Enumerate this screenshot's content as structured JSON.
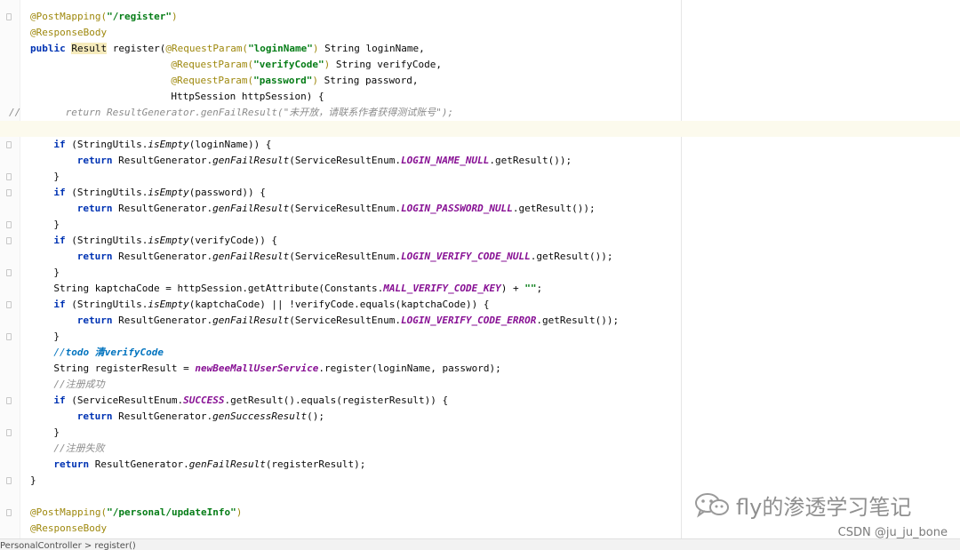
{
  "editor": {
    "lines": [
      {
        "i": 0,
        "fold": true,
        "tokens": [
          {
            "t": "@PostMapping(",
            "c": "ann"
          },
          {
            "t": "\"/register\"",
            "c": "str"
          },
          {
            "t": ")",
            "c": "ann"
          }
        ]
      },
      {
        "i": 0,
        "fold": false,
        "tokens": [
          {
            "t": "@ResponseBody",
            "c": "ann"
          }
        ]
      },
      {
        "i": 0,
        "fold": false,
        "tokens": [
          {
            "t": "public ",
            "c": "kw"
          },
          {
            "t": "Result",
            "c": "hl"
          },
          {
            "t": " register("
          },
          {
            "t": "@RequestParam(",
            "c": "ann"
          },
          {
            "t": "\"loginName\"",
            "c": "str"
          },
          {
            "t": ")",
            "c": "ann"
          },
          {
            "t": " String loginName,"
          }
        ]
      },
      {
        "i": 24,
        "fold": false,
        "tokens": [
          {
            "t": "@RequestParam(",
            "c": "ann"
          },
          {
            "t": "\"verifyCode\"",
            "c": "str"
          },
          {
            "t": ")",
            "c": "ann"
          },
          {
            "t": " String verifyCode,"
          }
        ]
      },
      {
        "i": 24,
        "fold": false,
        "tokens": [
          {
            "t": "@RequestParam(",
            "c": "ann"
          },
          {
            "t": "\"password\"",
            "c": "str"
          },
          {
            "t": ")",
            "c": "ann"
          },
          {
            "t": " String password,"
          }
        ]
      },
      {
        "i": 24,
        "fold": false,
        "tokens": [
          {
            "t": "HttpSession httpSession) {"
          }
        ]
      },
      {
        "i": 6,
        "fold": false,
        "prefix": "//",
        "tokens": [
          {
            "t": "return ResultGenerator.genFailResult(\"未开放，请联系作者获得测试账号\");",
            "c": "cmt"
          }
        ]
      },
      {
        "i": 0,
        "fold": false,
        "current": true,
        "tokens": []
      },
      {
        "i": 4,
        "fold": true,
        "tokens": [
          {
            "t": "if ",
            "c": "kw"
          },
          {
            "t": "(StringUtils."
          },
          {
            "t": "isEmpty",
            "c": "it"
          },
          {
            "t": "(loginName)) {"
          }
        ]
      },
      {
        "i": 8,
        "fold": false,
        "tokens": [
          {
            "t": "return ",
            "c": "kw"
          },
          {
            "t": "ResultGenerator."
          },
          {
            "t": "genFailResult",
            "c": "it"
          },
          {
            "t": "(ServiceResultEnum."
          },
          {
            "t": "LOGIN_NAME_NULL",
            "c": "const"
          },
          {
            "t": ".getResult());"
          }
        ]
      },
      {
        "i": 4,
        "fold": true,
        "tokens": [
          {
            "t": "}"
          }
        ]
      },
      {
        "i": 4,
        "fold": true,
        "tokens": [
          {
            "t": "if ",
            "c": "kw"
          },
          {
            "t": "(StringUtils."
          },
          {
            "t": "isEmpty",
            "c": "it"
          },
          {
            "t": "(password)) {"
          }
        ]
      },
      {
        "i": 8,
        "fold": false,
        "tokens": [
          {
            "t": "return ",
            "c": "kw"
          },
          {
            "t": "ResultGenerator."
          },
          {
            "t": "genFailResult",
            "c": "it"
          },
          {
            "t": "(ServiceResultEnum."
          },
          {
            "t": "LOGIN_PASSWORD_NULL",
            "c": "const"
          },
          {
            "t": ".getResult());"
          }
        ]
      },
      {
        "i": 4,
        "fold": true,
        "tokens": [
          {
            "t": "}"
          }
        ]
      },
      {
        "i": 4,
        "fold": true,
        "tokens": [
          {
            "t": "if ",
            "c": "kw"
          },
          {
            "t": "(StringUtils."
          },
          {
            "t": "isEmpty",
            "c": "it"
          },
          {
            "t": "(verifyCode)) {"
          }
        ]
      },
      {
        "i": 8,
        "fold": false,
        "tokens": [
          {
            "t": "return ",
            "c": "kw"
          },
          {
            "t": "ResultGenerator."
          },
          {
            "t": "genFailResult",
            "c": "it"
          },
          {
            "t": "(ServiceResultEnum."
          },
          {
            "t": "LOGIN_VERIFY_CODE_NULL",
            "c": "const"
          },
          {
            "t": ".getResult());"
          }
        ]
      },
      {
        "i": 4,
        "fold": true,
        "tokens": [
          {
            "t": "}"
          }
        ]
      },
      {
        "i": 4,
        "fold": false,
        "tokens": [
          {
            "t": "String kaptchaCode = httpSession.getAttribute(Constants."
          },
          {
            "t": "MALL_VERIFY_CODE_KEY",
            "c": "const"
          },
          {
            "t": ") + "
          },
          {
            "t": "\"\"",
            "c": "str"
          },
          {
            "t": ";"
          }
        ]
      },
      {
        "i": 4,
        "fold": true,
        "tokens": [
          {
            "t": "if ",
            "c": "kw"
          },
          {
            "t": "(StringUtils."
          },
          {
            "t": "isEmpty",
            "c": "it"
          },
          {
            "t": "(kaptchaCode) || !verifyCode.equals(kaptchaCode)) {"
          }
        ]
      },
      {
        "i": 8,
        "fold": false,
        "tokens": [
          {
            "t": "return ",
            "c": "kw"
          },
          {
            "t": "ResultGenerator."
          },
          {
            "t": "genFailResult",
            "c": "it"
          },
          {
            "t": "(ServiceResultEnum."
          },
          {
            "t": "LOGIN_VERIFY_CODE_ERROR",
            "c": "const"
          },
          {
            "t": ".getResult());"
          }
        ]
      },
      {
        "i": 4,
        "fold": true,
        "tokens": [
          {
            "t": "}"
          }
        ]
      },
      {
        "i": 4,
        "fold": false,
        "tokens": [
          {
            "t": "//",
            "c": "doc"
          },
          {
            "t": "todo 清verifyCode",
            "c": "todo"
          }
        ]
      },
      {
        "i": 4,
        "fold": false,
        "tokens": [
          {
            "t": "String registerResult = "
          },
          {
            "t": "newBeeMallUserService",
            "c": "const"
          },
          {
            "t": ".register(loginName, password);"
          }
        ]
      },
      {
        "i": 4,
        "fold": false,
        "tokens": [
          {
            "t": "//注册成功",
            "c": "cmt"
          }
        ]
      },
      {
        "i": 4,
        "fold": true,
        "tokens": [
          {
            "t": "if ",
            "c": "kw"
          },
          {
            "t": "(ServiceResultEnum."
          },
          {
            "t": "SUCCESS",
            "c": "const"
          },
          {
            "t": ".getResult().equals(registerResult)) {"
          }
        ]
      },
      {
        "i": 8,
        "fold": false,
        "tokens": [
          {
            "t": "return ",
            "c": "kw"
          },
          {
            "t": "ResultGenerator."
          },
          {
            "t": "genSuccessResult",
            "c": "it"
          },
          {
            "t": "();"
          }
        ]
      },
      {
        "i": 4,
        "fold": true,
        "tokens": [
          {
            "t": "}"
          }
        ]
      },
      {
        "i": 4,
        "fold": false,
        "tokens": [
          {
            "t": "//注册失败",
            "c": "cmt"
          }
        ]
      },
      {
        "i": 4,
        "fold": false,
        "tokens": [
          {
            "t": "return ",
            "c": "kw"
          },
          {
            "t": "ResultGenerator."
          },
          {
            "t": "genFailResult",
            "c": "it"
          },
          {
            "t": "(registerResult);"
          }
        ]
      },
      {
        "i": 0,
        "fold": true,
        "tokens": [
          {
            "t": "}"
          }
        ]
      },
      {
        "i": 0,
        "fold": false,
        "tokens": []
      },
      {
        "i": 0,
        "fold": true,
        "tokens": [
          {
            "t": "@PostMapping(",
            "c": "ann"
          },
          {
            "t": "\"/personal/updateInfo\"",
            "c": "str"
          },
          {
            "t": ")",
            "c": "ann"
          }
        ]
      },
      {
        "i": 0,
        "fold": false,
        "tokens": [
          {
            "t": "@ResponseBody",
            "c": "ann"
          }
        ]
      }
    ]
  },
  "watermark": {
    "text": "fly的渗透学习笔记",
    "icon": "wechat-icon"
  },
  "csdn_credit": "CSDN @ju_ju_bone",
  "breadcrumb": {
    "text": "PersonalController  >  register()"
  },
  "colors": {
    "keyword": "#0033b3",
    "annotation": "#9e880d",
    "string": "#067d17",
    "constant": "#871094",
    "comment": "#8c8c8c",
    "todo": "#0073bf",
    "current_line": "#fcfaed",
    "highlight": "#f6ebbc"
  }
}
